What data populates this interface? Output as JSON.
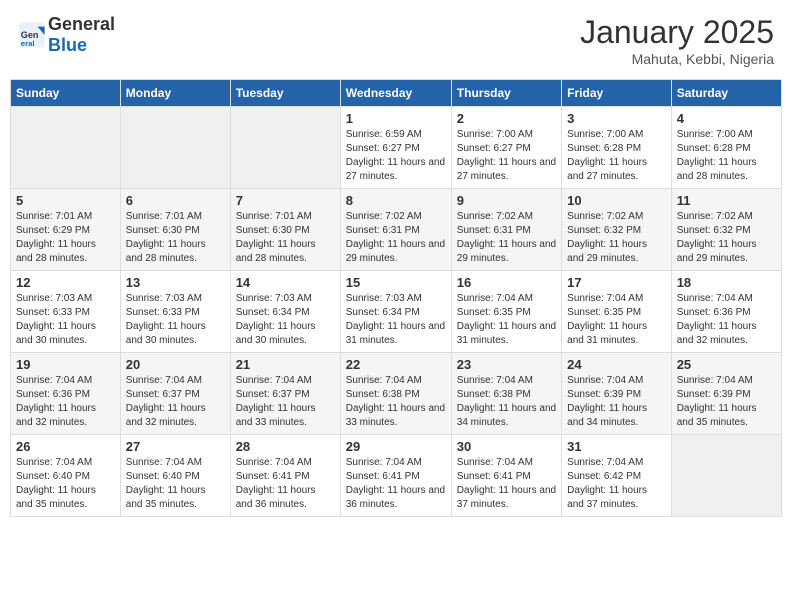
{
  "header": {
    "logo_general": "General",
    "logo_blue": "Blue",
    "month_title": "January 2025",
    "subtitle": "Mahuta, Kebbi, Nigeria"
  },
  "days_of_week": [
    "Sunday",
    "Monday",
    "Tuesday",
    "Wednesday",
    "Thursday",
    "Friday",
    "Saturday"
  ],
  "weeks": [
    [
      {
        "day": "",
        "info": ""
      },
      {
        "day": "",
        "info": ""
      },
      {
        "day": "",
        "info": ""
      },
      {
        "day": "1",
        "info": "Sunrise: 6:59 AM\nSunset: 6:27 PM\nDaylight: 11 hours and 27 minutes."
      },
      {
        "day": "2",
        "info": "Sunrise: 7:00 AM\nSunset: 6:27 PM\nDaylight: 11 hours and 27 minutes."
      },
      {
        "day": "3",
        "info": "Sunrise: 7:00 AM\nSunset: 6:28 PM\nDaylight: 11 hours and 27 minutes."
      },
      {
        "day": "4",
        "info": "Sunrise: 7:00 AM\nSunset: 6:28 PM\nDaylight: 11 hours and 28 minutes."
      }
    ],
    [
      {
        "day": "5",
        "info": "Sunrise: 7:01 AM\nSunset: 6:29 PM\nDaylight: 11 hours and 28 minutes."
      },
      {
        "day": "6",
        "info": "Sunrise: 7:01 AM\nSunset: 6:30 PM\nDaylight: 11 hours and 28 minutes."
      },
      {
        "day": "7",
        "info": "Sunrise: 7:01 AM\nSunset: 6:30 PM\nDaylight: 11 hours and 28 minutes."
      },
      {
        "day": "8",
        "info": "Sunrise: 7:02 AM\nSunset: 6:31 PM\nDaylight: 11 hours and 29 minutes."
      },
      {
        "day": "9",
        "info": "Sunrise: 7:02 AM\nSunset: 6:31 PM\nDaylight: 11 hours and 29 minutes."
      },
      {
        "day": "10",
        "info": "Sunrise: 7:02 AM\nSunset: 6:32 PM\nDaylight: 11 hours and 29 minutes."
      },
      {
        "day": "11",
        "info": "Sunrise: 7:02 AM\nSunset: 6:32 PM\nDaylight: 11 hours and 29 minutes."
      }
    ],
    [
      {
        "day": "12",
        "info": "Sunrise: 7:03 AM\nSunset: 6:33 PM\nDaylight: 11 hours and 30 minutes."
      },
      {
        "day": "13",
        "info": "Sunrise: 7:03 AM\nSunset: 6:33 PM\nDaylight: 11 hours and 30 minutes."
      },
      {
        "day": "14",
        "info": "Sunrise: 7:03 AM\nSunset: 6:34 PM\nDaylight: 11 hours and 30 minutes."
      },
      {
        "day": "15",
        "info": "Sunrise: 7:03 AM\nSunset: 6:34 PM\nDaylight: 11 hours and 31 minutes."
      },
      {
        "day": "16",
        "info": "Sunrise: 7:04 AM\nSunset: 6:35 PM\nDaylight: 11 hours and 31 minutes."
      },
      {
        "day": "17",
        "info": "Sunrise: 7:04 AM\nSunset: 6:35 PM\nDaylight: 11 hours and 31 minutes."
      },
      {
        "day": "18",
        "info": "Sunrise: 7:04 AM\nSunset: 6:36 PM\nDaylight: 11 hours and 32 minutes."
      }
    ],
    [
      {
        "day": "19",
        "info": "Sunrise: 7:04 AM\nSunset: 6:36 PM\nDaylight: 11 hours and 32 minutes."
      },
      {
        "day": "20",
        "info": "Sunrise: 7:04 AM\nSunset: 6:37 PM\nDaylight: 11 hours and 32 minutes."
      },
      {
        "day": "21",
        "info": "Sunrise: 7:04 AM\nSunset: 6:37 PM\nDaylight: 11 hours and 33 minutes."
      },
      {
        "day": "22",
        "info": "Sunrise: 7:04 AM\nSunset: 6:38 PM\nDaylight: 11 hours and 33 minutes."
      },
      {
        "day": "23",
        "info": "Sunrise: 7:04 AM\nSunset: 6:38 PM\nDaylight: 11 hours and 34 minutes."
      },
      {
        "day": "24",
        "info": "Sunrise: 7:04 AM\nSunset: 6:39 PM\nDaylight: 11 hours and 34 minutes."
      },
      {
        "day": "25",
        "info": "Sunrise: 7:04 AM\nSunset: 6:39 PM\nDaylight: 11 hours and 35 minutes."
      }
    ],
    [
      {
        "day": "26",
        "info": "Sunrise: 7:04 AM\nSunset: 6:40 PM\nDaylight: 11 hours and 35 minutes."
      },
      {
        "day": "27",
        "info": "Sunrise: 7:04 AM\nSunset: 6:40 PM\nDaylight: 11 hours and 35 minutes."
      },
      {
        "day": "28",
        "info": "Sunrise: 7:04 AM\nSunset: 6:41 PM\nDaylight: 11 hours and 36 minutes."
      },
      {
        "day": "29",
        "info": "Sunrise: 7:04 AM\nSunset: 6:41 PM\nDaylight: 11 hours and 36 minutes."
      },
      {
        "day": "30",
        "info": "Sunrise: 7:04 AM\nSunset: 6:41 PM\nDaylight: 11 hours and 37 minutes."
      },
      {
        "day": "31",
        "info": "Sunrise: 7:04 AM\nSunset: 6:42 PM\nDaylight: 11 hours and 37 minutes."
      },
      {
        "day": "",
        "info": ""
      }
    ]
  ]
}
